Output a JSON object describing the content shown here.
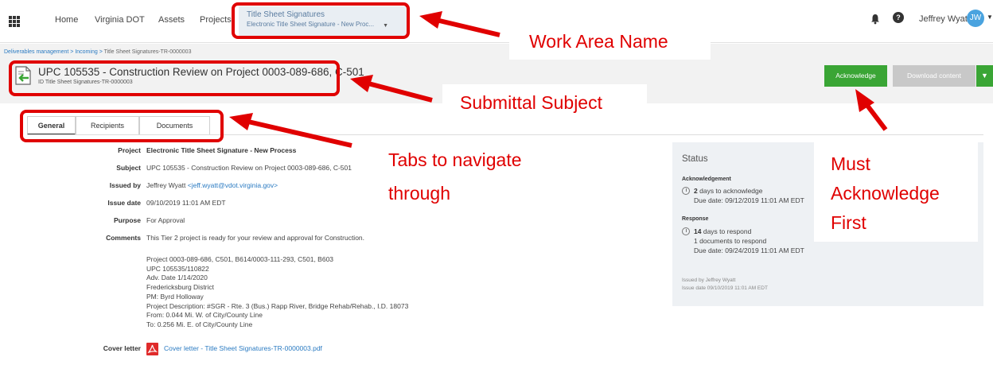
{
  "nav": {
    "links": [
      "Home",
      "Virginia DOT",
      "Assets",
      "Projects"
    ],
    "work_area": {
      "title": "Title Sheet Signatures",
      "subtitle": "Electronic Title Sheet Signature - New Proc..."
    },
    "user": {
      "name": "Jeffrey Wyatt",
      "initials": "JW"
    }
  },
  "breadcrumb": {
    "part1": "Deliverables management",
    "part2": "Incoming",
    "current": "Title Sheet Signatures-TR-0000003",
    "sep": ">"
  },
  "submittal": {
    "subject": "UPC 105535 - Construction Review on Project 0003-089-686, C-501",
    "id": "ID Title Sheet Signatures-TR-0000003"
  },
  "buttons": {
    "acknowledge": "Acknowledge",
    "download": "Download content"
  },
  "tabs": [
    "General",
    "Recipients",
    "Documents"
  ],
  "details": {
    "project_label": "Project",
    "project": "Electronic Title Sheet Signature - New Process",
    "subject_label": "Subject",
    "subject": "UPC 105535 - Construction Review on Project 0003-089-686, C-501",
    "issued_by_label": "Issued by",
    "issued_by_name": "Jeffrey Wyatt",
    "issued_by_email": "<jeff.wyatt@vdot.virginia.gov>",
    "issue_date_label": "Issue date",
    "issue_date": "09/10/2019 11:01 AM EDT",
    "purpose_label": "Purpose",
    "purpose": "For Approval",
    "comments_label": "Comments",
    "comments": "This Tier 2 project is ready for your review and approval for Construction.",
    "comment_lines": [
      "Project  0003-089-686, C501, B614/0003-111-293, C501, B603",
      "UPC 105535/110822",
      "Adv. Date 1/14/2020",
      "Fredericksburg District",
      "PM: Byrd Holloway",
      "Project Description:  #SGR - Rte. 3 (Bus.) Rapp River, Bridge Rehab/Rehab., I.D. 18073",
      "From: 0.044 Mi. W. of City/County Line",
      "To: 0.256 Mi. E. of City/County Line"
    ],
    "cover_letter_label": "Cover letter",
    "cover_letter": "Cover letter - Title Sheet Signatures-TR-0000003.pdf"
  },
  "status": {
    "title": "Status",
    "ack_heading": "Acknowledgement",
    "ack_days": "2",
    "ack_days_text": "days to acknowledge",
    "ack_due": "Due date: 09/12/2019 11:01 AM EDT",
    "resp_heading": "Response",
    "resp_days": "14",
    "resp_days_text": "days to respond",
    "resp_docs": "1 documents to respond",
    "resp_due": "Due date: 09/24/2019 11:01 AM EDT",
    "foot_issued_by": "Issued by Jeffrey Wyatt",
    "foot_issue_date": "Issue date 09/10/2019 11:01 AM EDT"
  },
  "annotations": {
    "work_area_name": "Work Area Name",
    "submittal_subject": "Submittal Subject",
    "tabs_line1": "Tabs to navigate",
    "tabs_line2": "through",
    "must_line1": "Must",
    "must_line2": "Acknowledge",
    "must_line3": "First"
  },
  "colors": {
    "annotation_red": "#e00000",
    "accent_green": "#3aa535",
    "link_blue": "#2b7bc2",
    "avatar_blue": "#4aa3df"
  }
}
